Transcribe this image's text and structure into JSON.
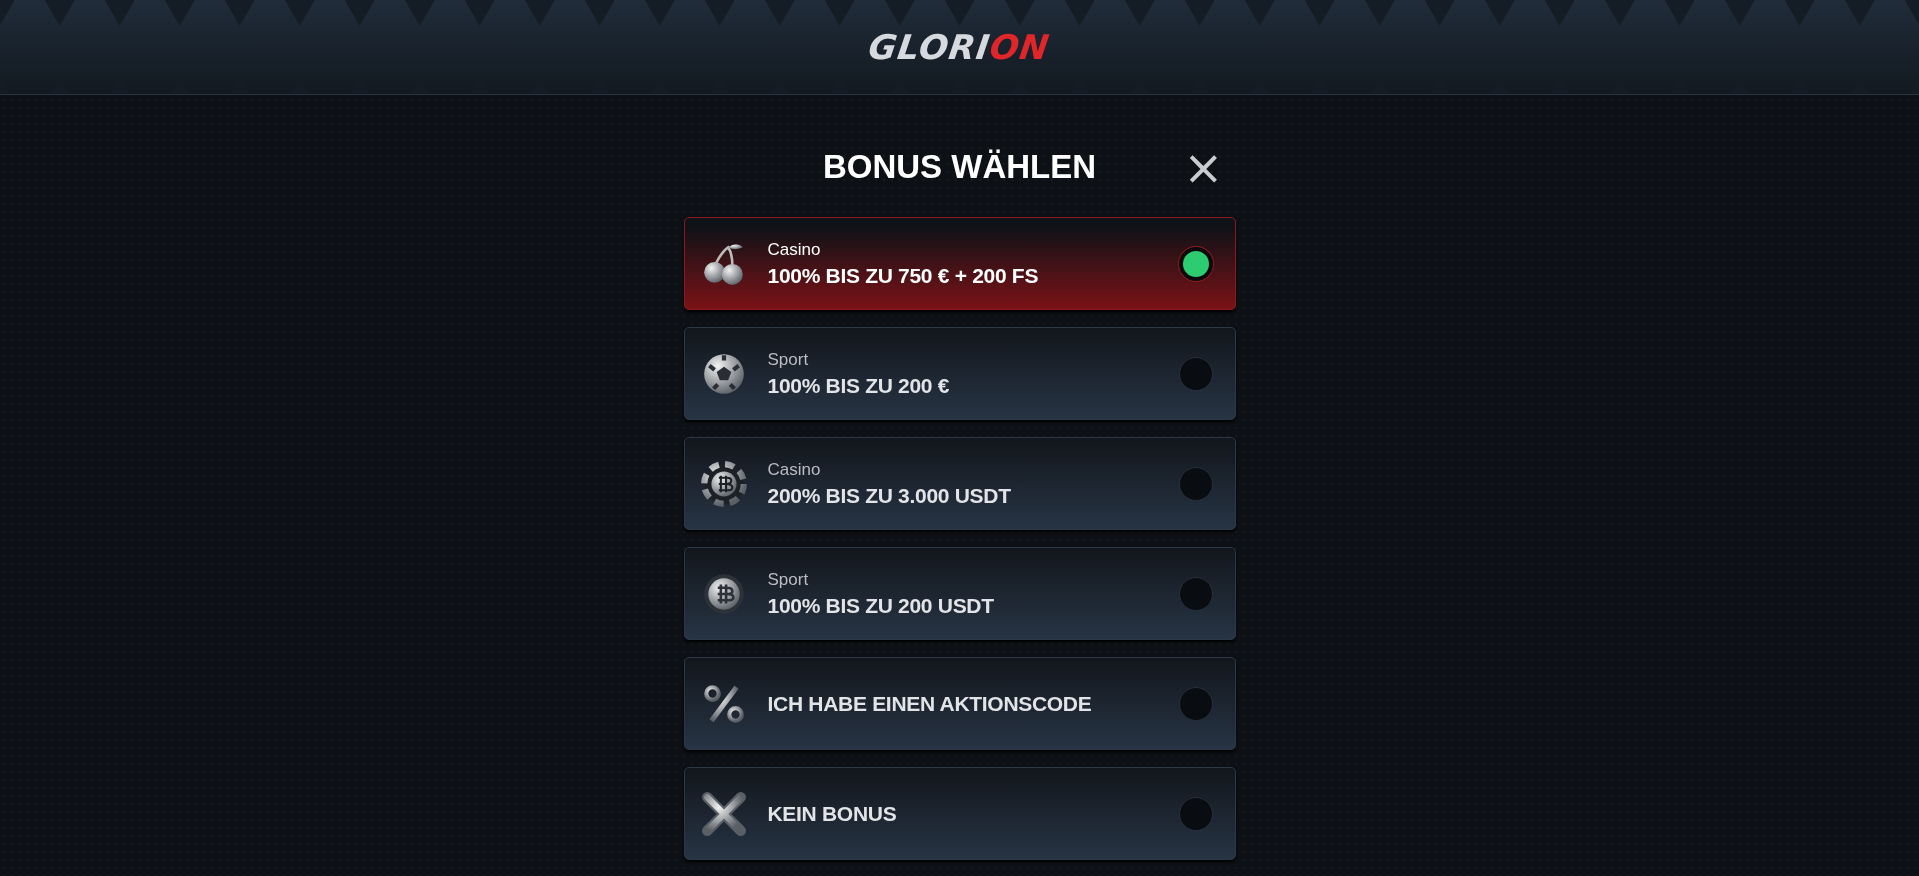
{
  "header": {
    "logo": {
      "text": "GLORI",
      "accent": "ON"
    }
  },
  "dialog": {
    "title": "BONUS WÄHLEN",
    "close": "×",
    "options": [
      {
        "kind": "cherry",
        "category": "Casino",
        "offer": "100% BIS ZU 750 € + 200 FS",
        "selected": true
      },
      {
        "kind": "football",
        "category": "Sport",
        "offer": "100% BIS ZU 200 €",
        "selected": false
      },
      {
        "kind": "chip",
        "category": "Casino",
        "offer": "200% BIS ZU 3.000 USDT",
        "selected": false
      },
      {
        "kind": "coinball",
        "category": "Sport",
        "offer": "100% BIS ZU 200 USDT",
        "selected": false
      },
      {
        "kind": "percent",
        "offer": "ICH HABE EINEN AKTIONSCODE",
        "selected": false
      },
      {
        "kind": "cross",
        "offer": "KEIN BONUS",
        "selected": false
      }
    ]
  }
}
